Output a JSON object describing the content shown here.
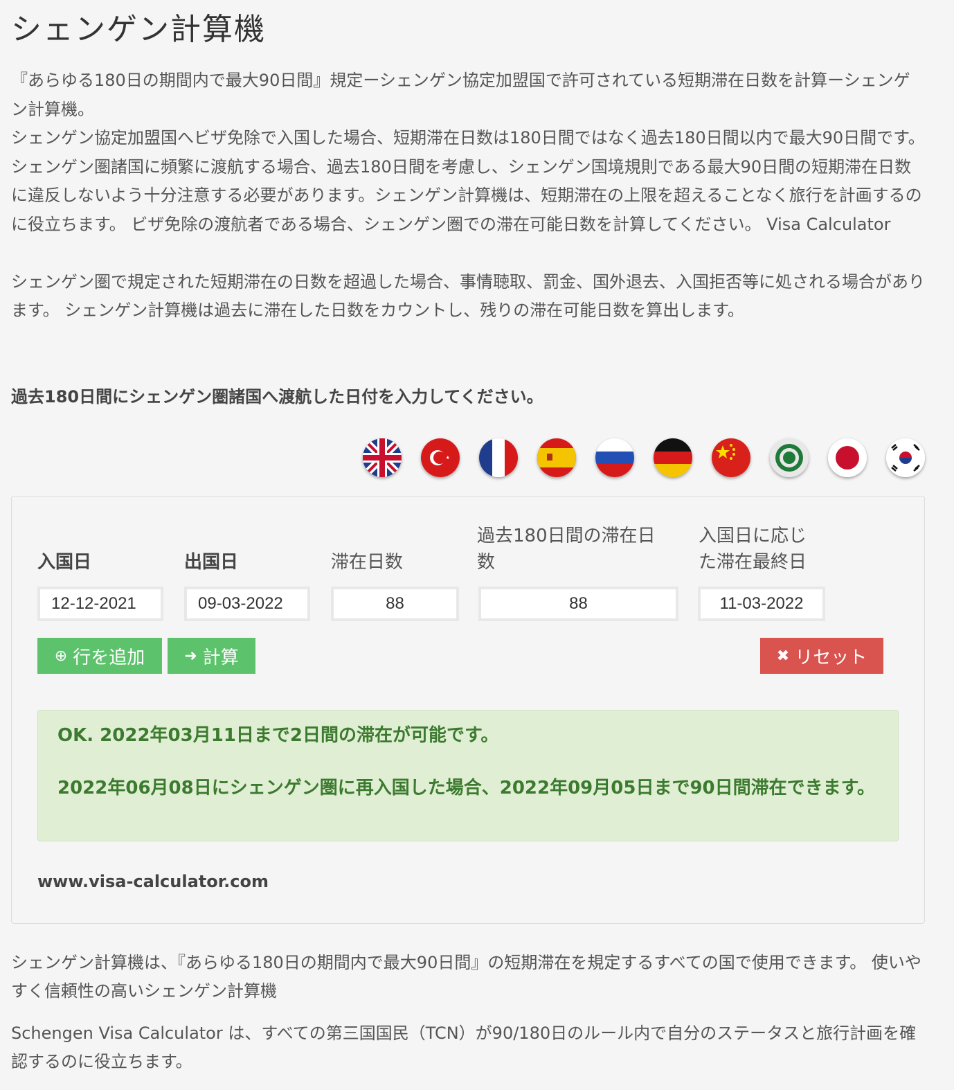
{
  "page": {
    "title": "シェンゲン計算機",
    "intro": [
      "『あらゆる180日の期間内で最大90日間』規定ーシェンゲン協定加盟国で許可されている短期滞在日数を計算ーシェンゲン計算機。",
      "シェンゲン協定加盟国へビザ免除で入国した場合、短期滞在日数は180日間ではなく過去180日間以内で最大90日間です。 シェンゲン圏諸国に頻繁に渡航する場合、過去180日間を考慮し、シェンゲン国境規則である最大90日間の短期滞在日数に違反しないよう十分注意する必要があります。シェンゲン計算機は、短期滞在の上限を超えることなく旅行を計画するのに役立ちます。 ビザ免除の渡航者である場合、シェンゲン圏での滞在可能日数を計算してください。 Visa Calculator",
      "シェンゲン圏で規定された短期滞在の日数を超過した場合、事情聴取、罰金、国外退去、入国拒否等に処される場合があります。 シェンゲン計算機は過去に滞在した日数をカウントし、残りの滞在可能日数を算出します。"
    ],
    "prompt": "過去180日間にシェンゲン圏諸国へ渡航した日付を入力してください。"
  },
  "flags": [
    {
      "name": "uk-flag-icon"
    },
    {
      "name": "turkey-flag-icon"
    },
    {
      "name": "france-flag-icon"
    },
    {
      "name": "spain-flag-icon"
    },
    {
      "name": "russia-flag-icon"
    },
    {
      "name": "germany-flag-icon"
    },
    {
      "name": "china-flag-icon"
    },
    {
      "name": "arab-league-flag-icon"
    },
    {
      "name": "japan-flag-icon"
    },
    {
      "name": "korea-flag-icon"
    }
  ],
  "calculator": {
    "headers": {
      "entry": "入国日",
      "exit": "出国日",
      "stay_days": "滞在日数",
      "past_180_line1": "過去180日間の滞在日",
      "past_180_line2": "数",
      "last_day_line1": "入国日に応じ",
      "last_day_line2": "た滞在最終日"
    },
    "row": {
      "entry": "12-12-2021",
      "exit": "09-03-2022",
      "stay_days": "88",
      "past_180": "88",
      "last_day": "11-03-2022"
    },
    "buttons": {
      "add_row": "行を追加",
      "calculate": "計算",
      "reset": "リセット"
    },
    "result_line1": "OK. 2022年03月11日まで2日間の滞在が可能です。",
    "result_line2": "2022年06月08日にシェンゲン圏に再入国した場合、2022年09月05日まで90日間滞在できます。",
    "site": "www.visa-calculator.com"
  },
  "outro": [
    "シェンゲン計算機は、『あらゆる180日の期間内で最大90日間』の短期滞在を規定するすべての国で使用できます。 使いやすく信頼性の高いシェンゲン計算機",
    "Schengen Visa Calculator は、すべての第三国国民（TCN）が90/180日のルール内で自分のステータスと旅行計画を確認するのに役立ちます。"
  ],
  "colors": {
    "green_button": "#5cc36c",
    "red_button": "#d9534f",
    "alert_bg": "#e0efd4",
    "alert_text": "#3c7a2f"
  }
}
